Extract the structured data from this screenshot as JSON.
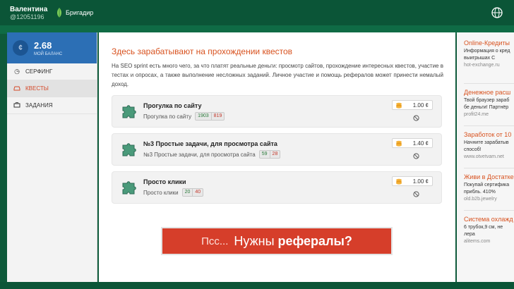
{
  "header": {
    "user_name": "Валентина",
    "user_id": "@12051196",
    "rank": "Бригадир",
    "globe_icon": "globe-icon"
  },
  "sidebar": {
    "balance_value": "2.68",
    "balance_label": "МОЙ БАЛАНС",
    "items": [
      {
        "label": "СЕРФИНГ",
        "icon": "clock-icon",
        "active": false
      },
      {
        "label": "КВЕСТЫ",
        "icon": "car-icon",
        "active": true
      },
      {
        "label": "ЗАДАНИЯ",
        "icon": "briefcase-icon",
        "active": false
      }
    ]
  },
  "main": {
    "title": "Здесь зарабатывают на прохождении квестов",
    "intro": "На SEO sprint есть много чего, за что платят реальные деньги: просмотр сайтов, прохождение интересных квестов, участие в тестах и опросах, а также выполнение несложных заданий. Личное участие и помощь рефералов может принести немалый доход.",
    "quests": [
      {
        "title": "Прогулка по сайту",
        "subtitle": "Прогулка по сайту",
        "count_done": "1903",
        "count_fail": "819",
        "price": "1.00 ¢"
      },
      {
        "title": "№3 Простые задачи, для просмотра сайта",
        "subtitle": "№3 Простые задачи, для просмотра сайта",
        "count_done": "59",
        "count_fail": "28",
        "price": "1.40 ¢"
      },
      {
        "title": "Просто клики",
        "subtitle": "Просто клики",
        "count_done": "20",
        "count_fail": "40",
        "price": "1.00 ¢"
      }
    ],
    "banner": {
      "part1": "Псс...",
      "part2": "Нужны",
      "part3": "рефералы?"
    }
  },
  "ads": [
    {
      "title": "Online-Кредиты ",
      "desc": "Информация о кред",
      "desc2": "выигрышах С",
      "url": "hot-exchange.ru"
    },
    {
      "title": "Денежное расш",
      "desc": "Твой браузер зараб",
      "desc2": "бе деньги! Партнёр",
      "url": "profit24.me"
    },
    {
      "title": "Заработок от 10",
      "desc": "Начните зарабатыв",
      "desc2": "способ!",
      "url": "www.otvetvam.net"
    },
    {
      "title": "Живи в Достатке",
      "desc": "Покупай сертифика",
      "desc2": "прибль. 410%",
      "url": "old.b2b.jewelry"
    },
    {
      "title": "Система охлажд",
      "desc": "6 трубок,9 см, не",
      "desc2": "лера",
      "url": "alitems.com"
    }
  ],
  "colors": {
    "accent": "#d8521f",
    "header": "#0b5537",
    "balance": "#2c6fb5",
    "banner": "#d63e2a"
  }
}
